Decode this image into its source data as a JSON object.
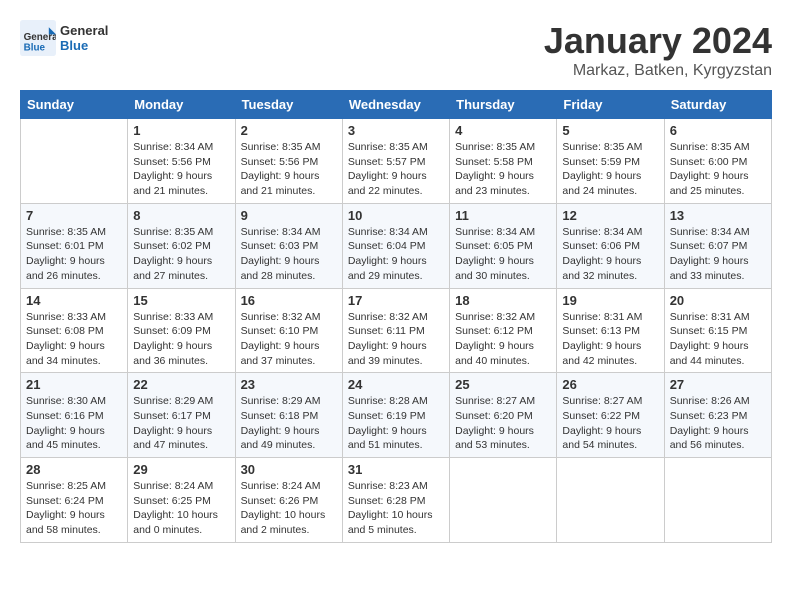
{
  "logo": {
    "general": "General",
    "blue": "Blue"
  },
  "title": "January 2024",
  "location": "Markaz, Batken, Kyrgyzstan",
  "days_of_week": [
    "Sunday",
    "Monday",
    "Tuesday",
    "Wednesday",
    "Thursday",
    "Friday",
    "Saturday"
  ],
  "weeks": [
    [
      {
        "day": "",
        "sunrise": "",
        "sunset": "",
        "daylight": ""
      },
      {
        "day": "1",
        "sunrise": "Sunrise: 8:34 AM",
        "sunset": "Sunset: 5:56 PM",
        "daylight": "Daylight: 9 hours and 21 minutes."
      },
      {
        "day": "2",
        "sunrise": "Sunrise: 8:35 AM",
        "sunset": "Sunset: 5:56 PM",
        "daylight": "Daylight: 9 hours and 21 minutes."
      },
      {
        "day": "3",
        "sunrise": "Sunrise: 8:35 AM",
        "sunset": "Sunset: 5:57 PM",
        "daylight": "Daylight: 9 hours and 22 minutes."
      },
      {
        "day": "4",
        "sunrise": "Sunrise: 8:35 AM",
        "sunset": "Sunset: 5:58 PM",
        "daylight": "Daylight: 9 hours and 23 minutes."
      },
      {
        "day": "5",
        "sunrise": "Sunrise: 8:35 AM",
        "sunset": "Sunset: 5:59 PM",
        "daylight": "Daylight: 9 hours and 24 minutes."
      },
      {
        "day": "6",
        "sunrise": "Sunrise: 8:35 AM",
        "sunset": "Sunset: 6:00 PM",
        "daylight": "Daylight: 9 hours and 25 minutes."
      }
    ],
    [
      {
        "day": "7",
        "sunrise": "Sunrise: 8:35 AM",
        "sunset": "Sunset: 6:01 PM",
        "daylight": "Daylight: 9 hours and 26 minutes."
      },
      {
        "day": "8",
        "sunrise": "Sunrise: 8:35 AM",
        "sunset": "Sunset: 6:02 PM",
        "daylight": "Daylight: 9 hours and 27 minutes."
      },
      {
        "day": "9",
        "sunrise": "Sunrise: 8:34 AM",
        "sunset": "Sunset: 6:03 PM",
        "daylight": "Daylight: 9 hours and 28 minutes."
      },
      {
        "day": "10",
        "sunrise": "Sunrise: 8:34 AM",
        "sunset": "Sunset: 6:04 PM",
        "daylight": "Daylight: 9 hours and 29 minutes."
      },
      {
        "day": "11",
        "sunrise": "Sunrise: 8:34 AM",
        "sunset": "Sunset: 6:05 PM",
        "daylight": "Daylight: 9 hours and 30 minutes."
      },
      {
        "day": "12",
        "sunrise": "Sunrise: 8:34 AM",
        "sunset": "Sunset: 6:06 PM",
        "daylight": "Daylight: 9 hours and 32 minutes."
      },
      {
        "day": "13",
        "sunrise": "Sunrise: 8:34 AM",
        "sunset": "Sunset: 6:07 PM",
        "daylight": "Daylight: 9 hours and 33 minutes."
      }
    ],
    [
      {
        "day": "14",
        "sunrise": "Sunrise: 8:33 AM",
        "sunset": "Sunset: 6:08 PM",
        "daylight": "Daylight: 9 hours and 34 minutes."
      },
      {
        "day": "15",
        "sunrise": "Sunrise: 8:33 AM",
        "sunset": "Sunset: 6:09 PM",
        "daylight": "Daylight: 9 hours and 36 minutes."
      },
      {
        "day": "16",
        "sunrise": "Sunrise: 8:32 AM",
        "sunset": "Sunset: 6:10 PM",
        "daylight": "Daylight: 9 hours and 37 minutes."
      },
      {
        "day": "17",
        "sunrise": "Sunrise: 8:32 AM",
        "sunset": "Sunset: 6:11 PM",
        "daylight": "Daylight: 9 hours and 39 minutes."
      },
      {
        "day": "18",
        "sunrise": "Sunrise: 8:32 AM",
        "sunset": "Sunset: 6:12 PM",
        "daylight": "Daylight: 9 hours and 40 minutes."
      },
      {
        "day": "19",
        "sunrise": "Sunrise: 8:31 AM",
        "sunset": "Sunset: 6:13 PM",
        "daylight": "Daylight: 9 hours and 42 minutes."
      },
      {
        "day": "20",
        "sunrise": "Sunrise: 8:31 AM",
        "sunset": "Sunset: 6:15 PM",
        "daylight": "Daylight: 9 hours and 44 minutes."
      }
    ],
    [
      {
        "day": "21",
        "sunrise": "Sunrise: 8:30 AM",
        "sunset": "Sunset: 6:16 PM",
        "daylight": "Daylight: 9 hours and 45 minutes."
      },
      {
        "day": "22",
        "sunrise": "Sunrise: 8:29 AM",
        "sunset": "Sunset: 6:17 PM",
        "daylight": "Daylight: 9 hours and 47 minutes."
      },
      {
        "day": "23",
        "sunrise": "Sunrise: 8:29 AM",
        "sunset": "Sunset: 6:18 PM",
        "daylight": "Daylight: 9 hours and 49 minutes."
      },
      {
        "day": "24",
        "sunrise": "Sunrise: 8:28 AM",
        "sunset": "Sunset: 6:19 PM",
        "daylight": "Daylight: 9 hours and 51 minutes."
      },
      {
        "day": "25",
        "sunrise": "Sunrise: 8:27 AM",
        "sunset": "Sunset: 6:20 PM",
        "daylight": "Daylight: 9 hours and 53 minutes."
      },
      {
        "day": "26",
        "sunrise": "Sunrise: 8:27 AM",
        "sunset": "Sunset: 6:22 PM",
        "daylight": "Daylight: 9 hours and 54 minutes."
      },
      {
        "day": "27",
        "sunrise": "Sunrise: 8:26 AM",
        "sunset": "Sunset: 6:23 PM",
        "daylight": "Daylight: 9 hours and 56 minutes."
      }
    ],
    [
      {
        "day": "28",
        "sunrise": "Sunrise: 8:25 AM",
        "sunset": "Sunset: 6:24 PM",
        "daylight": "Daylight: 9 hours and 58 minutes."
      },
      {
        "day": "29",
        "sunrise": "Sunrise: 8:24 AM",
        "sunset": "Sunset: 6:25 PM",
        "daylight": "Daylight: 10 hours and 0 minutes."
      },
      {
        "day": "30",
        "sunrise": "Sunrise: 8:24 AM",
        "sunset": "Sunset: 6:26 PM",
        "daylight": "Daylight: 10 hours and 2 minutes."
      },
      {
        "day": "31",
        "sunrise": "Sunrise: 8:23 AM",
        "sunset": "Sunset: 6:28 PM",
        "daylight": "Daylight: 10 hours and 5 minutes."
      },
      {
        "day": "",
        "sunrise": "",
        "sunset": "",
        "daylight": ""
      },
      {
        "day": "",
        "sunrise": "",
        "sunset": "",
        "daylight": ""
      },
      {
        "day": "",
        "sunrise": "",
        "sunset": "",
        "daylight": ""
      }
    ]
  ]
}
